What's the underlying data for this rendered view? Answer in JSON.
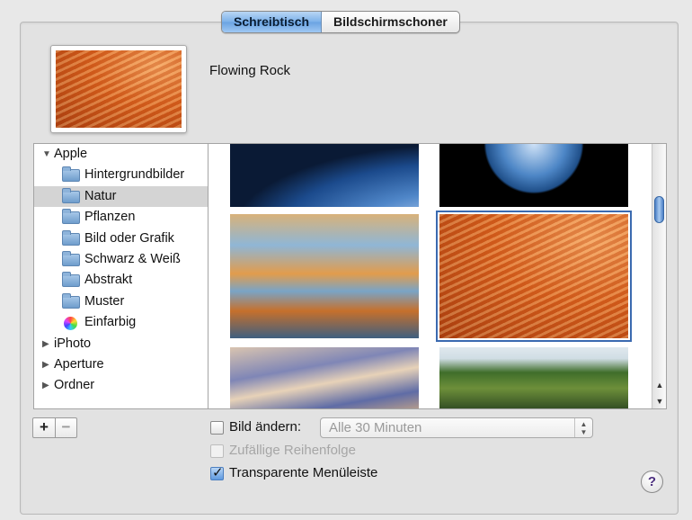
{
  "tabs": [
    {
      "label": "Schreibtisch",
      "active": true
    },
    {
      "label": "Bildschirmschoner",
      "active": false
    }
  ],
  "preview": {
    "name": "Flowing Rock"
  },
  "sources": {
    "apple": "Apple",
    "folders": [
      "Hintergrundbilder",
      "Natur",
      "Pflanzen",
      "Bild oder Grafik",
      "Schwarz & Weiß",
      "Abstrakt",
      "Muster"
    ],
    "solid": "Einfarbig",
    "iphoto": "iPhoto",
    "aperture": "Aperture",
    "ordner": "Ordner",
    "selected": "Natur"
  },
  "tray": {
    "plus": "+",
    "minus": "−"
  },
  "options": {
    "change_picture": "Bild ändern:",
    "interval": "Alle 30 Minuten",
    "random_order": "Zufällige Reihenfolge",
    "translucent_menu": "Transparente Menüleiste",
    "help": "?"
  },
  "icons": {
    "expanded": "▼",
    "collapsed": "▶",
    "up": "▲",
    "down": "▼"
  },
  "colors": {
    "accent": "#6aa3e2",
    "selection": "#d4d4d4"
  }
}
